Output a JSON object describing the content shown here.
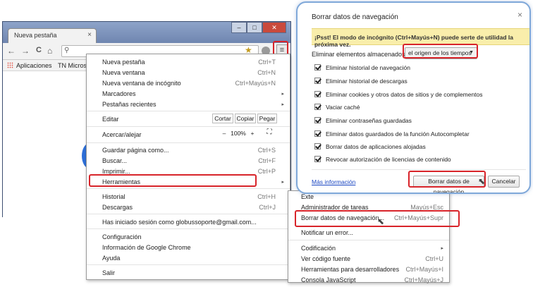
{
  "browser": {
    "tab_title": "Nueva pestaña",
    "tab_close": "×",
    "window_min": "–",
    "window_max": "□",
    "window_close": "✕",
    "back": "←",
    "forward": "→",
    "reload": "C",
    "home": "⌂",
    "search_glyph": "⚲",
    "star": "★",
    "menu_glyph": "≡",
    "bookmarks": {
      "apps": "Aplicaciones",
      "item2": "TN Microsoft"
    },
    "icons": [
      "back-icon",
      "forward-icon",
      "reload-icon",
      "home-icon",
      "search-icon",
      "star-icon",
      "extension-icon",
      "hamburger-menu-icon",
      "apps-grid-icon"
    ]
  },
  "menu": {
    "items": [
      {
        "label": "Nueva pestaña",
        "shortcut": "Ctrl+T"
      },
      {
        "label": "Nueva ventana",
        "shortcut": "Ctrl+N"
      },
      {
        "label": "Nueva ventana de incógnito",
        "shortcut": "Ctrl+Mayús+N"
      },
      {
        "label": "Marcadores",
        "arrow": "▸"
      },
      {
        "label": "Pestañas recientes",
        "arrow": "▸"
      },
      {
        "label": "Editar"
      },
      {
        "label": "Acercar/alejar"
      },
      {
        "label": "Guardar página como...",
        "shortcut": "Ctrl+S"
      },
      {
        "label": "Buscar...",
        "shortcut": "Ctrl+F"
      },
      {
        "label": "Imprimir...",
        "shortcut": "Ctrl+P"
      },
      {
        "label": "Herramientas",
        "arrow": "▸"
      },
      {
        "label": "Historial",
        "shortcut": "Ctrl+H"
      },
      {
        "label": "Descargas",
        "shortcut": "Ctrl+J"
      },
      {
        "label": "Has iniciado sesión como globussoporte@gmail.com..."
      },
      {
        "label": "Configuración"
      },
      {
        "label": "Información de Google Chrome"
      },
      {
        "label": "Ayuda"
      },
      {
        "label": "Salir"
      }
    ],
    "edit": {
      "cut": "Cortar",
      "copy": "Copiar",
      "paste": "Pegar"
    },
    "zoom": {
      "minus": "–",
      "value": "100%",
      "plus": "+",
      "fullscreen": "⛶"
    }
  },
  "submenu": {
    "items": [
      {
        "label": "Exte",
        "shortcut": ""
      },
      {
        "label": "Administrador de tareas",
        "shortcut": "Mayús+Esc"
      },
      {
        "label": "Borrar datos de navegación...",
        "shortcut": "Ctrl+Mayús+Supr"
      },
      {
        "label": "Notificar un error...",
        "shortcut": ""
      },
      {
        "label": "Codificación",
        "shortcut": "",
        "arrow": "▸"
      },
      {
        "label": "Ver código fuente",
        "shortcut": "Ctrl+U"
      },
      {
        "label": "Herramientas para desarrolladores",
        "shortcut": "Ctrl+Mayús+I"
      },
      {
        "label": "Consola JavaScript",
        "shortcut": "Ctrl+Mayús+J"
      }
    ]
  },
  "dialog": {
    "title": "Borrar datos de navegación",
    "close": "×",
    "tip": "¡Psst! El modo de incógnito (Ctrl+Mayús+N) puede serte de utilidad la próxima vez.",
    "remove_label": "Eliminar elementos almacenados desde:",
    "range": "el origen de los tiempos",
    "range_caret": "▼",
    "checkboxes": [
      "Eliminar historial de navegación",
      "Eliminar historial de descargas",
      "Eliminar cookies y otros datos de sitios y de complementos",
      "Vaciar caché",
      "Eliminar contraseñas guardadas",
      "Eliminar datos guardados de la función Autocompletar",
      "Borrar datos de aplicaciones alojadas",
      "Revocar autorización de licencias de contenido"
    ],
    "more_info": "Más información",
    "clear_button": "Borrar datos de navegación",
    "cancel_button": "Cancelar"
  },
  "colors": {
    "highlight": "#d8242a",
    "tip_bg": "#f9eeab",
    "link": "#1a46c2",
    "dialog_border": "#7fa8d9"
  }
}
